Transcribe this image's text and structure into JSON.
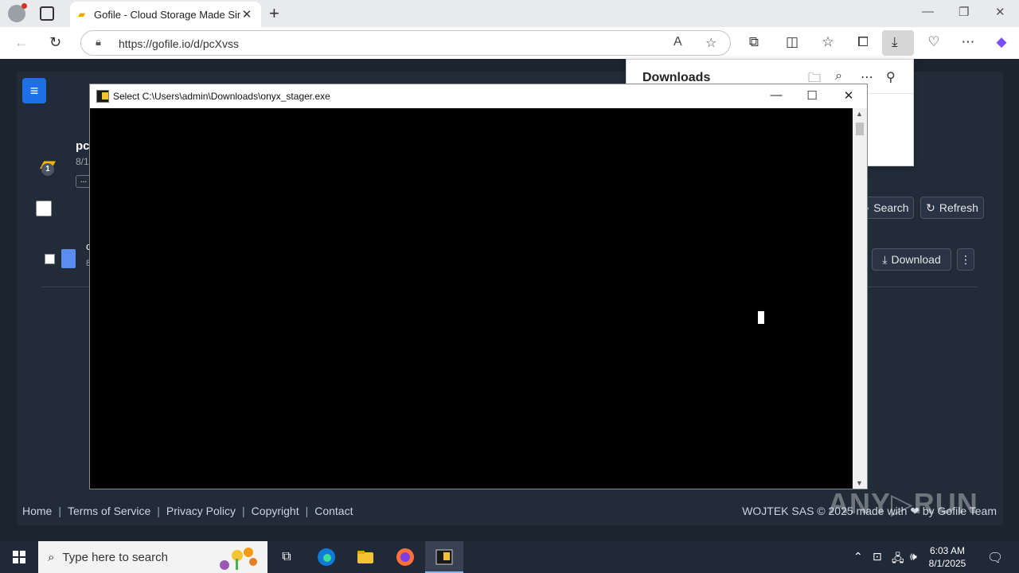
{
  "browser": {
    "tab_title": "Gofile - Cloud Storage Made Simple",
    "url": "https://gofile.io/d/pcXvss"
  },
  "downloads_panel": {
    "title": "Downloads"
  },
  "page": {
    "folder_title": "pc",
    "folder_date": "8/1",
    "folder_badge": "1",
    "more_label": "...",
    "file_letter_1": "o",
    "file_letter_2": "8",
    "search_label": "Search",
    "refresh_label": "Refresh",
    "download_label": "Download"
  },
  "console": {
    "title": "Select C:\\Users\\admin\\Downloads\\onyx_stager.exe"
  },
  "footer": {
    "links": [
      "Home",
      "Terms of Service",
      "Privacy Policy",
      "Copyright",
      "Contact"
    ],
    "separator": "|",
    "right_text": "WOJTEK SAS © 2025 made with ❤ by Gofile Team"
  },
  "watermark": "ANY▷RUN",
  "taskbar": {
    "search_placeholder": "Type here to search",
    "time": "6:03 AM",
    "date": "8/1/2025"
  },
  "colors": {
    "accent": "#1e6fe8",
    "folder": "#f4b400",
    "page_bg": "#1c2430"
  }
}
